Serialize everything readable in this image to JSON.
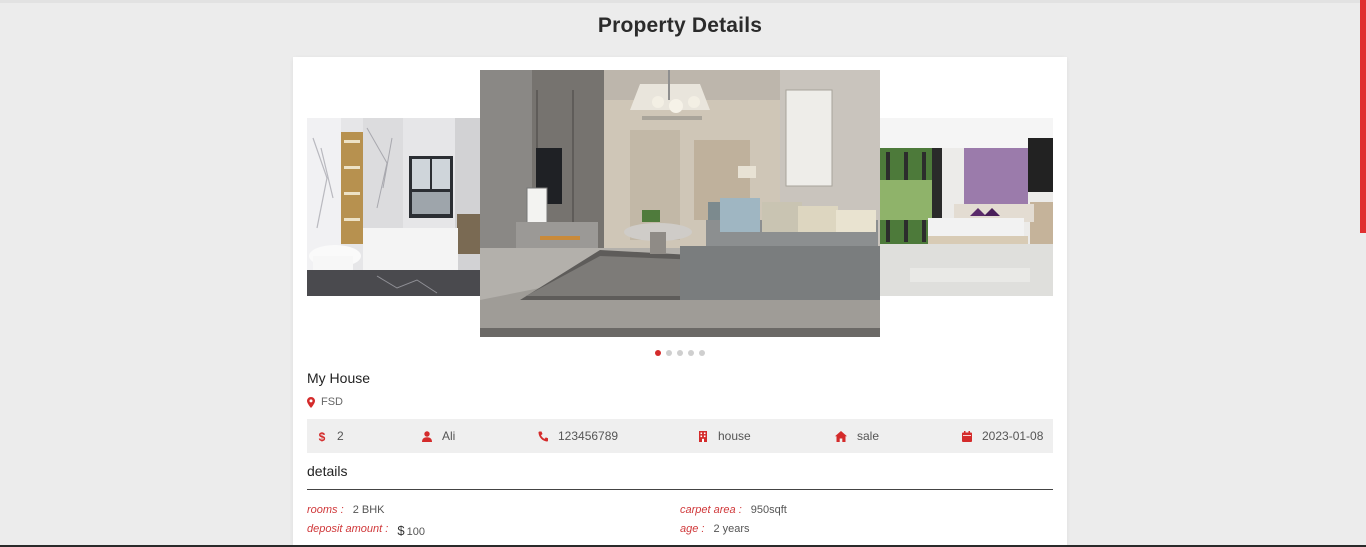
{
  "page": {
    "title": "Property Details"
  },
  "carousel": {
    "slides": [
      "bathroom",
      "living-room",
      "bedroom"
    ],
    "dots": 5,
    "active_dot": 0
  },
  "property": {
    "name": "My House",
    "location": "FSD"
  },
  "info_bar": {
    "price": "2",
    "owner": "Ali",
    "phone": "123456789",
    "type": "house",
    "purpose": "sale",
    "date": "2023-01-08"
  },
  "details": {
    "title": "details",
    "rooms_label": "rooms :",
    "rooms_value": "2 BHK",
    "carpet_label": "carpet area :",
    "carpet_value": "950sqft",
    "deposit_label": "deposit amount :",
    "deposit_symbol": "$",
    "deposit_value": "100",
    "age_label": "age :",
    "age_value": "2 years"
  },
  "colors": {
    "accent": "#d42b2b",
    "background": "#ececec",
    "card": "#ffffff",
    "info_bar": "#efefef"
  },
  "icons": {
    "location": "map-pin-icon",
    "price": "dollar-icon",
    "owner": "user-icon",
    "phone": "phone-icon",
    "type": "building-icon",
    "purpose": "home-icon",
    "date": "calendar-icon"
  }
}
